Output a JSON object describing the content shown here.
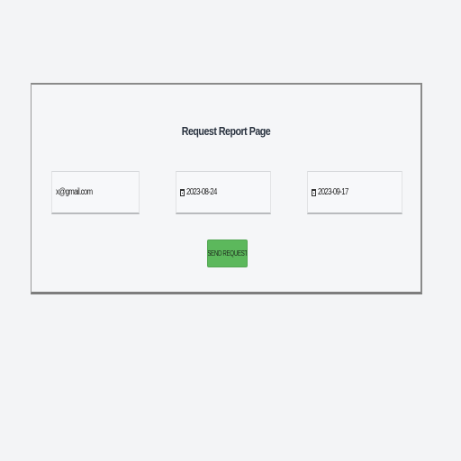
{
  "page": {
    "title": "Request Report Page"
  },
  "form": {
    "email_value": "x@gmail.com",
    "start_date_value": "2023-08-24",
    "end_date_value": "2023-09-17",
    "submit_label": "SEND REQUEST"
  },
  "colors": {
    "button": "#5cb85c",
    "background": "#f3f4f6"
  },
  "icons": {
    "date_field_icon": "calendar-icon"
  }
}
